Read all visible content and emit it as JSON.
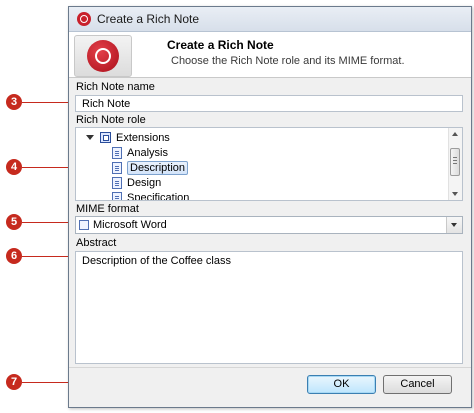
{
  "window": {
    "title": "Create a Rich Note"
  },
  "header": {
    "title": "Create a Rich Note",
    "subtitle": "Choose the Rich Note role and its MIME format."
  },
  "name_field": {
    "label": "Rich Note name",
    "value": "Rich Note"
  },
  "role_tree": {
    "label": "Rich Note role",
    "root": "Extensions",
    "items": [
      "Analysis",
      "Description",
      "Design",
      "Specification"
    ],
    "selected": "Description"
  },
  "mime": {
    "label": "MIME format",
    "value": "Microsoft Word"
  },
  "abstract": {
    "label": "Abstract",
    "value": "Description of the Coffee class"
  },
  "buttons": {
    "ok": "OK",
    "cancel": "Cancel"
  },
  "callouts": [
    "3",
    "4",
    "5",
    "6",
    "7"
  ],
  "colors": {
    "callout": "#c62a1e",
    "selection": "#d3e4fa",
    "logo": "#c8202b"
  }
}
